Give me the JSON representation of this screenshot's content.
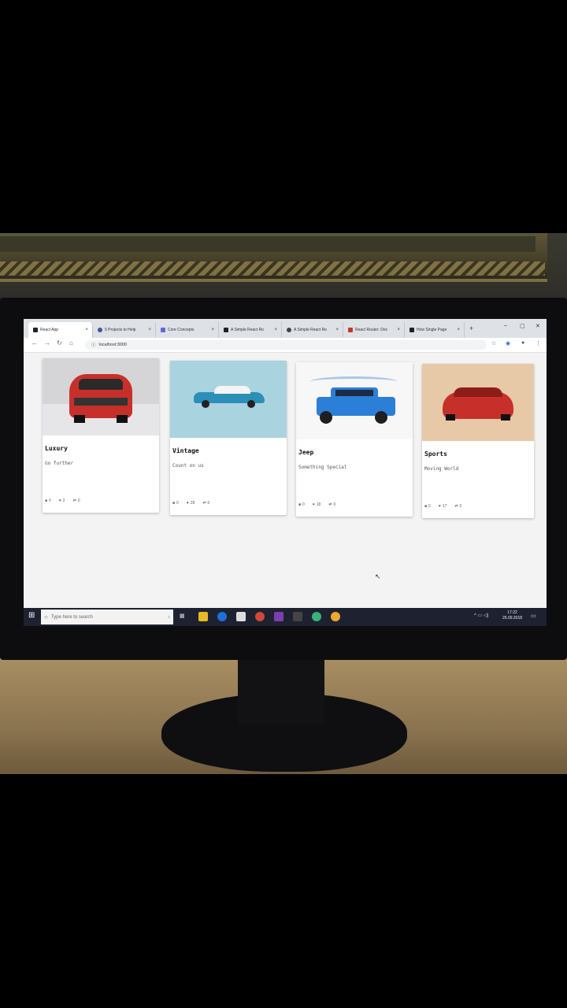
{
  "browser": {
    "tabs": [
      {
        "label": "React App",
        "active": true
      },
      {
        "label": "5 Projects to Help",
        "active": false
      },
      {
        "label": "Core Concepts",
        "active": false
      },
      {
        "label": "A Simple React Ro",
        "active": false
      },
      {
        "label": "A Simple React Ro",
        "active": false
      },
      {
        "label": "React Router: Dec",
        "active": false
      },
      {
        "label": "How Single Page",
        "active": false
      }
    ],
    "url": "localhost:3000"
  },
  "cards": [
    {
      "title": "Luxury",
      "subtitle": "Go further",
      "comments": "0",
      "likes": "2",
      "retweets": "0"
    },
    {
      "title": "Vintage",
      "subtitle": "Count on us",
      "comments": "0",
      "likes": "28",
      "retweets": "0"
    },
    {
      "title": "Jeep",
      "subtitle": "Something Special",
      "comments": "0",
      "likes": "18",
      "retweets": "0"
    },
    {
      "title": "Sports",
      "subtitle": "Moving World",
      "comments": "0",
      "likes": "17",
      "retweets": "0"
    }
  ],
  "taskbar": {
    "search_placeholder": "Type here to search",
    "time": "17:22",
    "date": "26.09.2018"
  },
  "colors": {
    "card_red": "#c7302a",
    "card_blue": "#2b8fb8",
    "jeep_blue": "#2b7fd6"
  }
}
